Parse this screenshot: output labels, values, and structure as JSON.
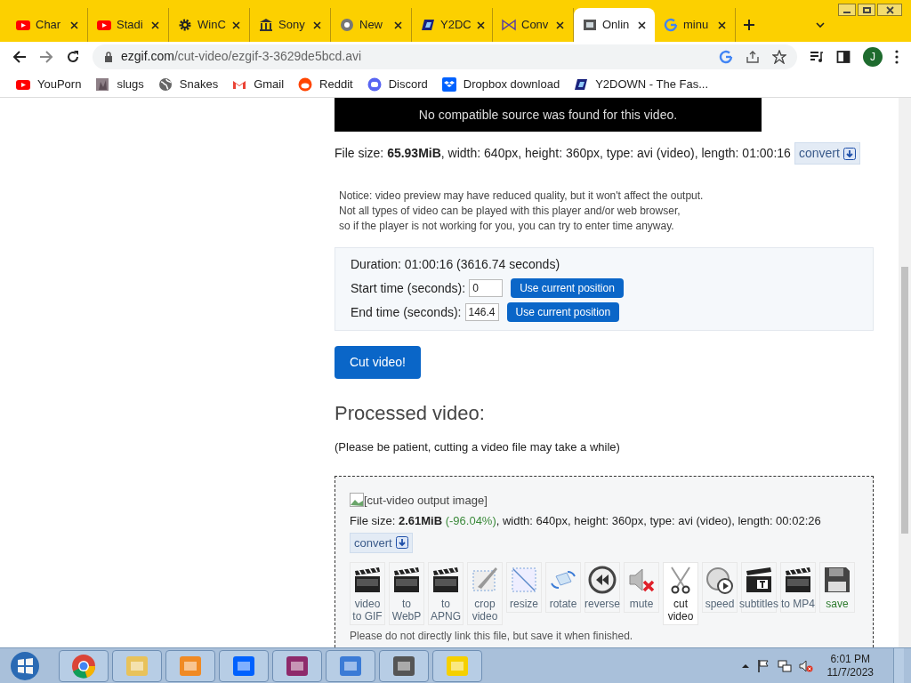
{
  "tabs": [
    {
      "title": "Char",
      "selected": false
    },
    {
      "title": "Stadi",
      "selected": false
    },
    {
      "title": "WinC",
      "selected": false
    },
    {
      "title": "Sony",
      "selected": false
    },
    {
      "title": "New",
      "selected": false
    },
    {
      "title": "Y2DC",
      "selected": false
    },
    {
      "title": "Conv",
      "selected": false
    },
    {
      "title": "Onlin",
      "selected": true
    },
    {
      "title": "minu",
      "selected": false
    }
  ],
  "address": {
    "url_host": "ezgif.com",
    "url_path": "/cut-video/ezgif-3-3629de5bcd.avi"
  },
  "profile": {
    "initial": "J"
  },
  "bookmarks": [
    {
      "label": "YouPorn"
    },
    {
      "label": "slugs"
    },
    {
      "label": "Snakes"
    },
    {
      "label": "Gmail"
    },
    {
      "label": "Reddit"
    },
    {
      "label": "Discord"
    },
    {
      "label": "Dropbox download"
    },
    {
      "label": "Y2DOWN - The Fas..."
    }
  ],
  "page": {
    "player_message": "No compatible source was found for this video.",
    "file_info": "File size: **65.93MiB**, width: 640px, height: 360px, type: avi (video), length: 01:00:16",
    "convert_label": "convert",
    "notice": [
      "Notice: video preview may have reduced quality, but it won't affect the output.",
      "Not all types of video can be played with this player and/or web browser,",
      "so if the player is not working for you, you can try to enter time anyway."
    ],
    "duration": "Duration: 01:00:16 (3616.74 seconds)",
    "start_label": "Start time (seconds):",
    "start_value": "0",
    "end_label": "End time (seconds):",
    "end_value": "146.4",
    "use_position": [
      "Use current position",
      "Use current position"
    ],
    "cut_button": "Cut video!",
    "processed_heading": "Processed video:",
    "patience": "(Please be patient, cutting a video file may take a while)",
    "output_alt": "[cut-video output image]",
    "output_info_start": "File size: **2.61MiB**",
    "output_change": "(-96.04%)",
    "output_info_end": ", width: 640px, height: 360px, type: avi (video), length: 00:02:26",
    "output_convert": "convert",
    "tools": [
      {
        "label": "video to GIF",
        "kind": "clapper",
        "selected": false
      },
      {
        "label": "to WebP",
        "kind": "clapper",
        "selected": false
      },
      {
        "label": "to APNG",
        "kind": "clapper",
        "selected": false
      },
      {
        "label": "crop video",
        "kind": "crop",
        "selected": false
      },
      {
        "label": "resize",
        "kind": "resize",
        "selected": false
      },
      {
        "label": "rotate",
        "kind": "rotate",
        "selected": false
      },
      {
        "label": "reverse",
        "kind": "reverse",
        "selected": false
      },
      {
        "label": "mute",
        "kind": "mute",
        "selected": false
      },
      {
        "label": "cut video",
        "kind": "scissors",
        "selected": true
      },
      {
        "label": "speed",
        "kind": "speed",
        "selected": false
      },
      {
        "label": "subtitles",
        "kind": "subtitles",
        "selected": false
      },
      {
        "label": "to MP4",
        "kind": "clapper",
        "selected": false
      },
      {
        "label": "save",
        "kind": "save",
        "selected": false
      }
    ],
    "footer_note": "Please do not directly link this file, but save it when finished."
  },
  "taskbar": {
    "time": "6:01 PM",
    "date": "11/7/2023"
  }
}
